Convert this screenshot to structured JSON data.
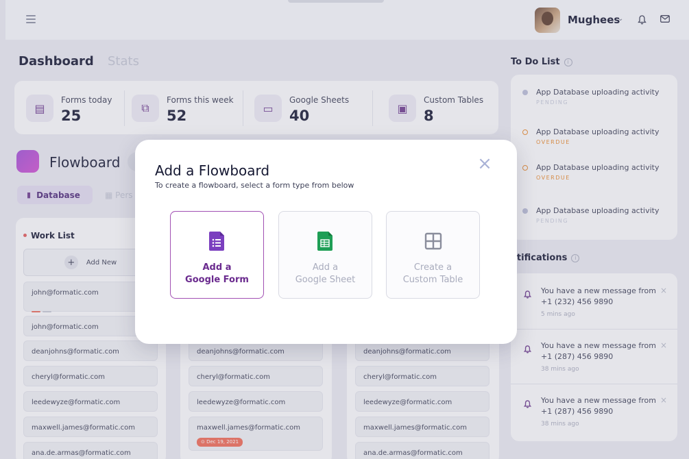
{
  "header": {
    "user_name": "Mughees",
    "caret": "⌄",
    "bell_icon": "🔔",
    "mail_icon": "✉"
  },
  "tabs": {
    "dashboard": "Dashboard",
    "stats": "Stats"
  },
  "stats": [
    {
      "label": "Forms today",
      "value": "25",
      "icon": "▤"
    },
    {
      "label": "Forms this week",
      "value": "52",
      "icon": "⧉"
    },
    {
      "label": "Google Sheets",
      "value": "40",
      "icon": "▭"
    },
    {
      "label": "Custom Tables",
      "value": "8",
      "icon": "▣"
    }
  ],
  "flowboard": {
    "title": "Flowboard",
    "chip_database": "Database",
    "chip_personal": "Pers"
  },
  "worklist": {
    "title": "Work List",
    "add_new": "Add New",
    "col1": [
      "john@formatic.com",
      "john@formatic.com",
      "deanjohns@formatic.com",
      "cheryl@formatic.com",
      "leedewyze@formatic.com",
      "maxwell.james@formatic.com",
      "ana.de.armas@formatic.com"
    ],
    "col2": [
      "deanjohns@formatic.com",
      "cheryl@formatic.com",
      "leedewyze@formatic.com",
      "maxwell.james@formatic.com"
    ],
    "col2_badge": "⊙ Dec 19, 2021",
    "col3": [
      "deanjohns@formatic.com",
      "cheryl@formatic.com",
      "leedewyze@formatic.com",
      "maxwell.james@formatic.com",
      "ana.de.armas@formatic.com"
    ],
    "priority_colors": [
      "#e86a5a",
      "#c6c8d4"
    ]
  },
  "todo": {
    "title": "To Do List",
    "info": "i",
    "items": [
      {
        "text": "App Database uploading activity",
        "status": "PENDING",
        "color": "#b9bdd6"
      },
      {
        "text": "App Database uploading activity",
        "status": "OVERDUE",
        "color": "#e8892c"
      },
      {
        "text": "App Database uploading activity",
        "status": "OVERDUE",
        "color": "#e8892c"
      },
      {
        "text": "App Database uploading activity",
        "status": "PENDING",
        "color": "#b9bdd6"
      }
    ]
  },
  "notifications": {
    "title": "otifications",
    "info": "i",
    "items": [
      {
        "line1": "You have a new message from",
        "line2": "+1 (232) 456 9890",
        "ago": "5 mins ago"
      },
      {
        "line1": "You have a new message from",
        "line2": "+1 (287) 456 9890",
        "ago": "38 mins ago"
      },
      {
        "line1": "You have a new message from",
        "line2": "+1 (287) 456 9890",
        "ago": "38 mins ago"
      }
    ],
    "close": "×",
    "bell": "🔔"
  },
  "modal": {
    "title": "Add a Flowboard",
    "subtitle": "To create a flowboard, select a form type from below",
    "close": "×",
    "options": [
      {
        "line1": "Add a",
        "line2": "Google Form",
        "icon": "google-form-icon",
        "color": "#7b3fbf",
        "selected": true
      },
      {
        "line1": "Add a",
        "line2": "Google Sheet",
        "icon": "google-sheet-icon",
        "color": "#1e9e55",
        "selected": false
      },
      {
        "line1": "Create a",
        "line2": "Custom Table",
        "icon": "table-icon",
        "color": "#8a8d9c",
        "selected": false
      }
    ]
  }
}
